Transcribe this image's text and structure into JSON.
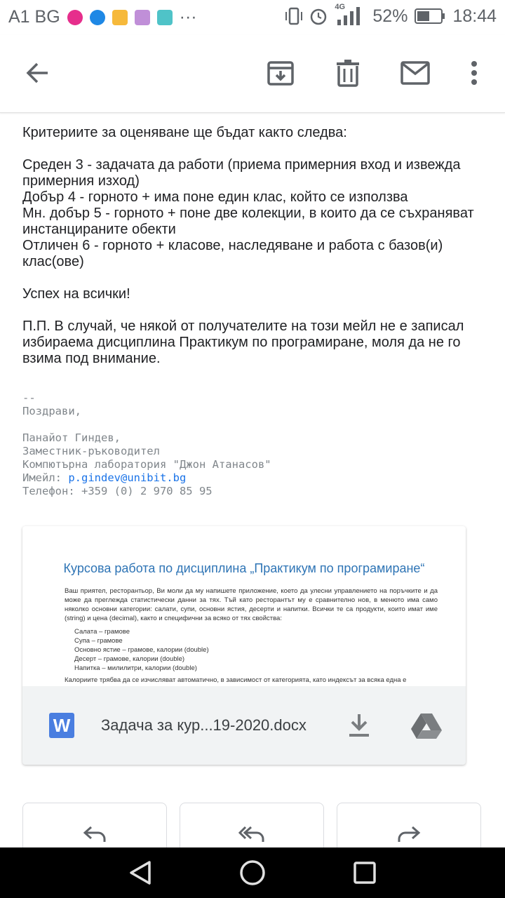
{
  "status_bar": {
    "carrier": "A1 BG",
    "network": "4G",
    "battery": "52%",
    "time": "18:44",
    "more": "···"
  },
  "toolbar": {
    "back_icon": "arrow-left",
    "archive_icon": "archive",
    "delete_icon": "trash",
    "mark_unread_icon": "envelope",
    "more_icon": "vertical-dots"
  },
  "email": {
    "paragraphs": [
      "Критериите за оценяване ще бъдат както следва:",
      "Среден 3 - задачата да работи (приема примерния вход и извежда примерния изход)\nДобър 4 - горното + има поне един клас, който се използва\nМн. добър 5 - горното + поне две колекции, в които да се съхраняват инстанцираните обекти\nОтличен 6 - горното + класове, наследяване и работа с базов(и) клас(ове)",
      "Успех на всички!",
      "П.П. В случай, че някой от получателите на този мейл не е записал избираема дисциплина Практикум по програмиране, моля да не го взима под внимание."
    ],
    "signature": {
      "separator": "--",
      "greeting": "Поздрави,",
      "name": "Панайот Гиндев,",
      "position": "Заместник-ръководител",
      "lab": "Компютърна лаборатория \"Джон Атанасов\"",
      "email_label": "Имейл: ",
      "email": "p.gindev@unibit.bg",
      "phone": "Телефон: +359 (0) 2 970 85 95"
    }
  },
  "attachment": {
    "preview_title": "Курсова работа по дисциплина „Практикум по програмиране“",
    "preview_text": "Ваш приятел, ресторантьор, Ви моли да му напишете приложение, което да улесни управлението на поръчките и да може да преглежда статистически данни за тях. Тъй като ресторантът му е сравнително нов, в менюто има само няколко основни категории: салати, супи, основни ястия, десерти и напитки. Всички те са продукти, които имат име (string) и цена (decimal), както и специфични за всяко от тях свойства:",
    "preview_list": [
      "Салата – грамове",
      "Супа – грамове",
      "Основно ястие – грамове, калории (double)",
      "Десерт – грамове, калории (double)",
      "Напитка – милилитри, калории (double)"
    ],
    "preview_footer": "Калориите трябва да се изчисляват автоматично, в зависимост от категорията, като индексът за всяка една е",
    "type_letter": "W",
    "filename": "Задача за кур...19-2020.docx",
    "download_icon": "download",
    "drive_icon": "google-drive"
  },
  "actions": {
    "reply_icon": "reply",
    "reply_all_icon": "reply-all",
    "forward_icon": "forward"
  },
  "nav": {
    "back_icon": "triangle-back",
    "home_icon": "circle-home",
    "recents_icon": "square-recents"
  }
}
